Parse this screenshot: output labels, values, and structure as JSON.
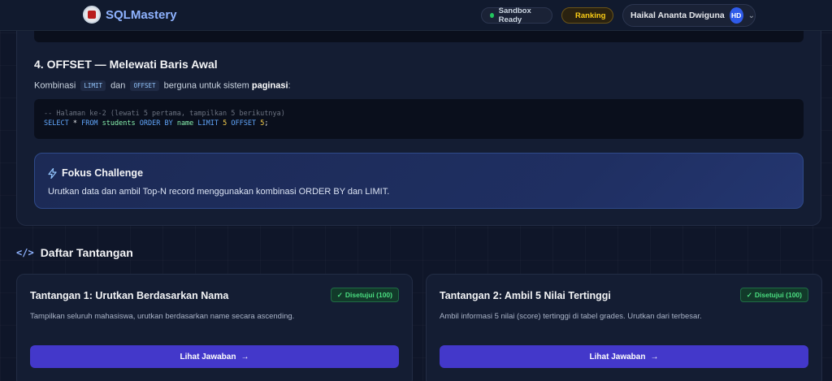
{
  "header": {
    "app_name": "SQLMastery",
    "sandbox_status": "Sandbox Ready",
    "ranking_label": "Ranking",
    "user_name": "Haikal Ananta Dwiguna",
    "user_initials": "HD"
  },
  "lesson": {
    "section_title": "4. OFFSET — Melewati Baris Awal",
    "desc_prefix": "Kombinasi",
    "kw_limit": "LIMIT",
    "desc_and": "dan",
    "kw_offset": "OFFSET",
    "desc_middle": "berguna untuk sistem",
    "desc_bold": "paginasi",
    "desc_suffix": ":",
    "code_comment": "-- Halaman ke-2 (lewati 5 pertama, tampilkan 5 berikutnya)",
    "code": {
      "select": "SELECT",
      "star": " * ",
      "from": "FROM",
      "table": " students ",
      "order_by": "ORDER BY",
      "col": " name ",
      "limit": "LIMIT",
      "limit_val": " 5 ",
      "offset": "OFFSET",
      "offset_val": " 5",
      "end": ";"
    }
  },
  "focus": {
    "title": "Fokus Challenge",
    "body": "Urutkan data dan ambil Top-N record menggunakan kombinasi ORDER BY dan LIMIT."
  },
  "challenges": {
    "title": "Daftar Tantangan",
    "items": [
      {
        "title": "Tantangan 1: Urutkan Berdasarkan Nama",
        "badge": "Disetujui (100)",
        "desc": "Tampilkan seluruh mahasiswa, urutkan berdasarkan name secara ascending.",
        "button": "Lihat Jawaban"
      },
      {
        "title": "Tantangan 2: Ambil 5 Nilai Tertinggi",
        "badge": "Disetujui (100)",
        "desc": "Ambil informasi 5 nilai (score) tertinggi di tabel grades. Urutkan dari terbesar.",
        "button": "Lihat Jawaban"
      }
    ]
  },
  "icons": {
    "logo": "university-logo-icon",
    "status_dot": "status-dot-icon",
    "ranking": "bar-chart-icon",
    "chevron": "chevron-down-icon",
    "focus": "lightning-icon",
    "list": "code-brackets-icon",
    "check": "check-icon",
    "arrow": "arrow-right-icon"
  },
  "colors": {
    "accent": "#4338ca",
    "brand": "#8fb3ff",
    "success": "#4ade80",
    "warning": "#facc15"
  }
}
